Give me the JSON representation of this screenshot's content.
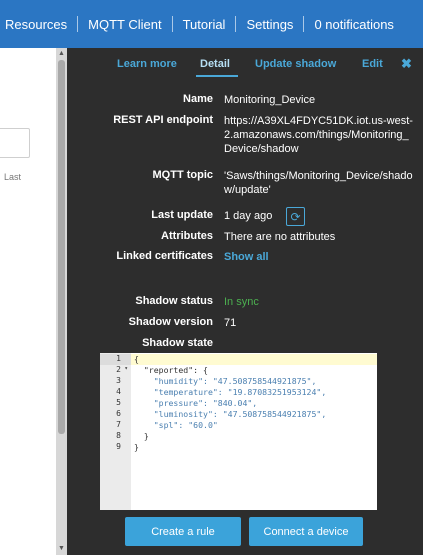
{
  "topnav": {
    "items": [
      "Resources",
      "MQTT Client",
      "Tutorial",
      "Settings",
      "0 notifications"
    ]
  },
  "left": {
    "partial_label": "Last"
  },
  "panel": {
    "tabs": [
      "Learn more",
      "Detail",
      "Update shadow",
      "Edit"
    ],
    "active_tab": "Detail",
    "close_glyph": "✖",
    "fields": {
      "name": {
        "label": "Name",
        "value": "Monitoring_Device"
      },
      "rest": {
        "label": "REST API endpoint",
        "value": "https://A39XL4FDYC51DK.iot.us-west-2.amazonaws.com/things/Monitoring_Device/shadow"
      },
      "mqtt": {
        "label": "MQTT topic",
        "value": "'Saws/things/Monitoring_Device/shadow/update'"
      },
      "last_update": {
        "label": "Last update",
        "value": "1 day ago"
      },
      "attributes": {
        "label": "Attributes",
        "value": "There are no attributes"
      },
      "linked": {
        "label": "Linked certificates",
        "value": "Show all"
      },
      "shadow_status": {
        "label": "Shadow status",
        "value": "In sync"
      },
      "shadow_version": {
        "label": "Shadow version",
        "value": "71"
      },
      "shadow_state": {
        "label": "Shadow state"
      }
    },
    "editor": {
      "line_numbers": [
        "1",
        "2",
        "3",
        "4",
        "5",
        "6",
        "7",
        "8",
        "9"
      ],
      "lines": [
        "{",
        "  \"reported\": {",
        "    \"humidity\": \"47.508758544921875\",",
        "    \"temperature\": \"19.87083251953124\",",
        "    \"pressure\": \"840.04\",",
        "    \"luminosity\": \"47.508758544921875\",",
        "    \"spl\": \"60.0\"",
        "  }",
        "}"
      ]
    },
    "buttons": {
      "create_rule": "Create a rule",
      "connect_device": "Connect a device"
    }
  },
  "colors": {
    "topbar": "#2b76c3",
    "panel_bg": "#2d2d2d",
    "accent": "#4aa8d8",
    "success": "#4caf50",
    "button": "#3ba3da"
  }
}
